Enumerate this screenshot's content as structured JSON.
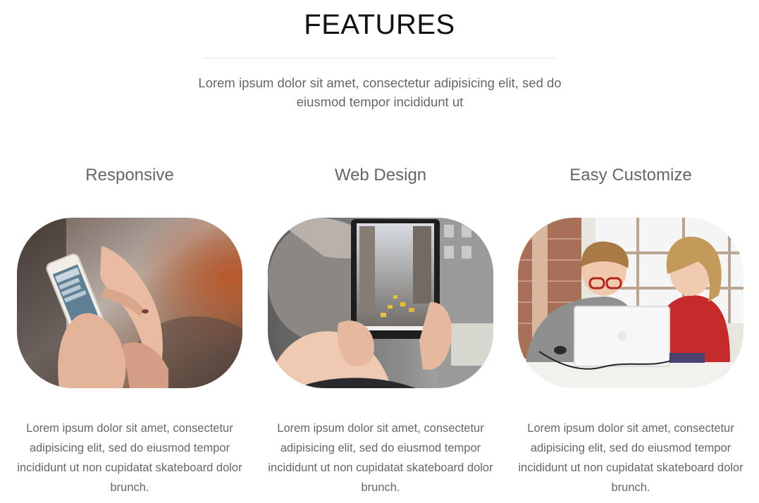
{
  "section": {
    "title": "FEATURES",
    "intro": "Lorem ipsum dolor sit amet, consectetur adipisicing elit, sed do eiusmod tempor incididunt ut"
  },
  "features": [
    {
      "heading": "Responsive",
      "image_subject": "hands holding a smartphone",
      "text": "Lorem ipsum dolor sit amet, consectetur adipisicing elit, sed do eiusmod tempor incididunt ut non cupidatat skateboard dolor brunch."
    },
    {
      "heading": "Web Design",
      "image_subject": "person holding a tablet showing a city street",
      "text": "Lorem ipsum dolor sit amet, consectetur adipisicing elit, sed do eiusmod tempor incididunt ut non cupidatat skateboard dolor brunch."
    },
    {
      "heading": "Easy Customize",
      "image_subject": "two children using a laptop",
      "text": "Lorem ipsum dolor sit amet, consectetur adipisicing elit, sed do eiusmod tempor incididunt ut non cupidatat skateboard dolor brunch."
    }
  ],
  "colors": {
    "title": "#111111",
    "body_text": "#666666",
    "rule": "#e6e6e6",
    "background": "#ffffff"
  }
}
